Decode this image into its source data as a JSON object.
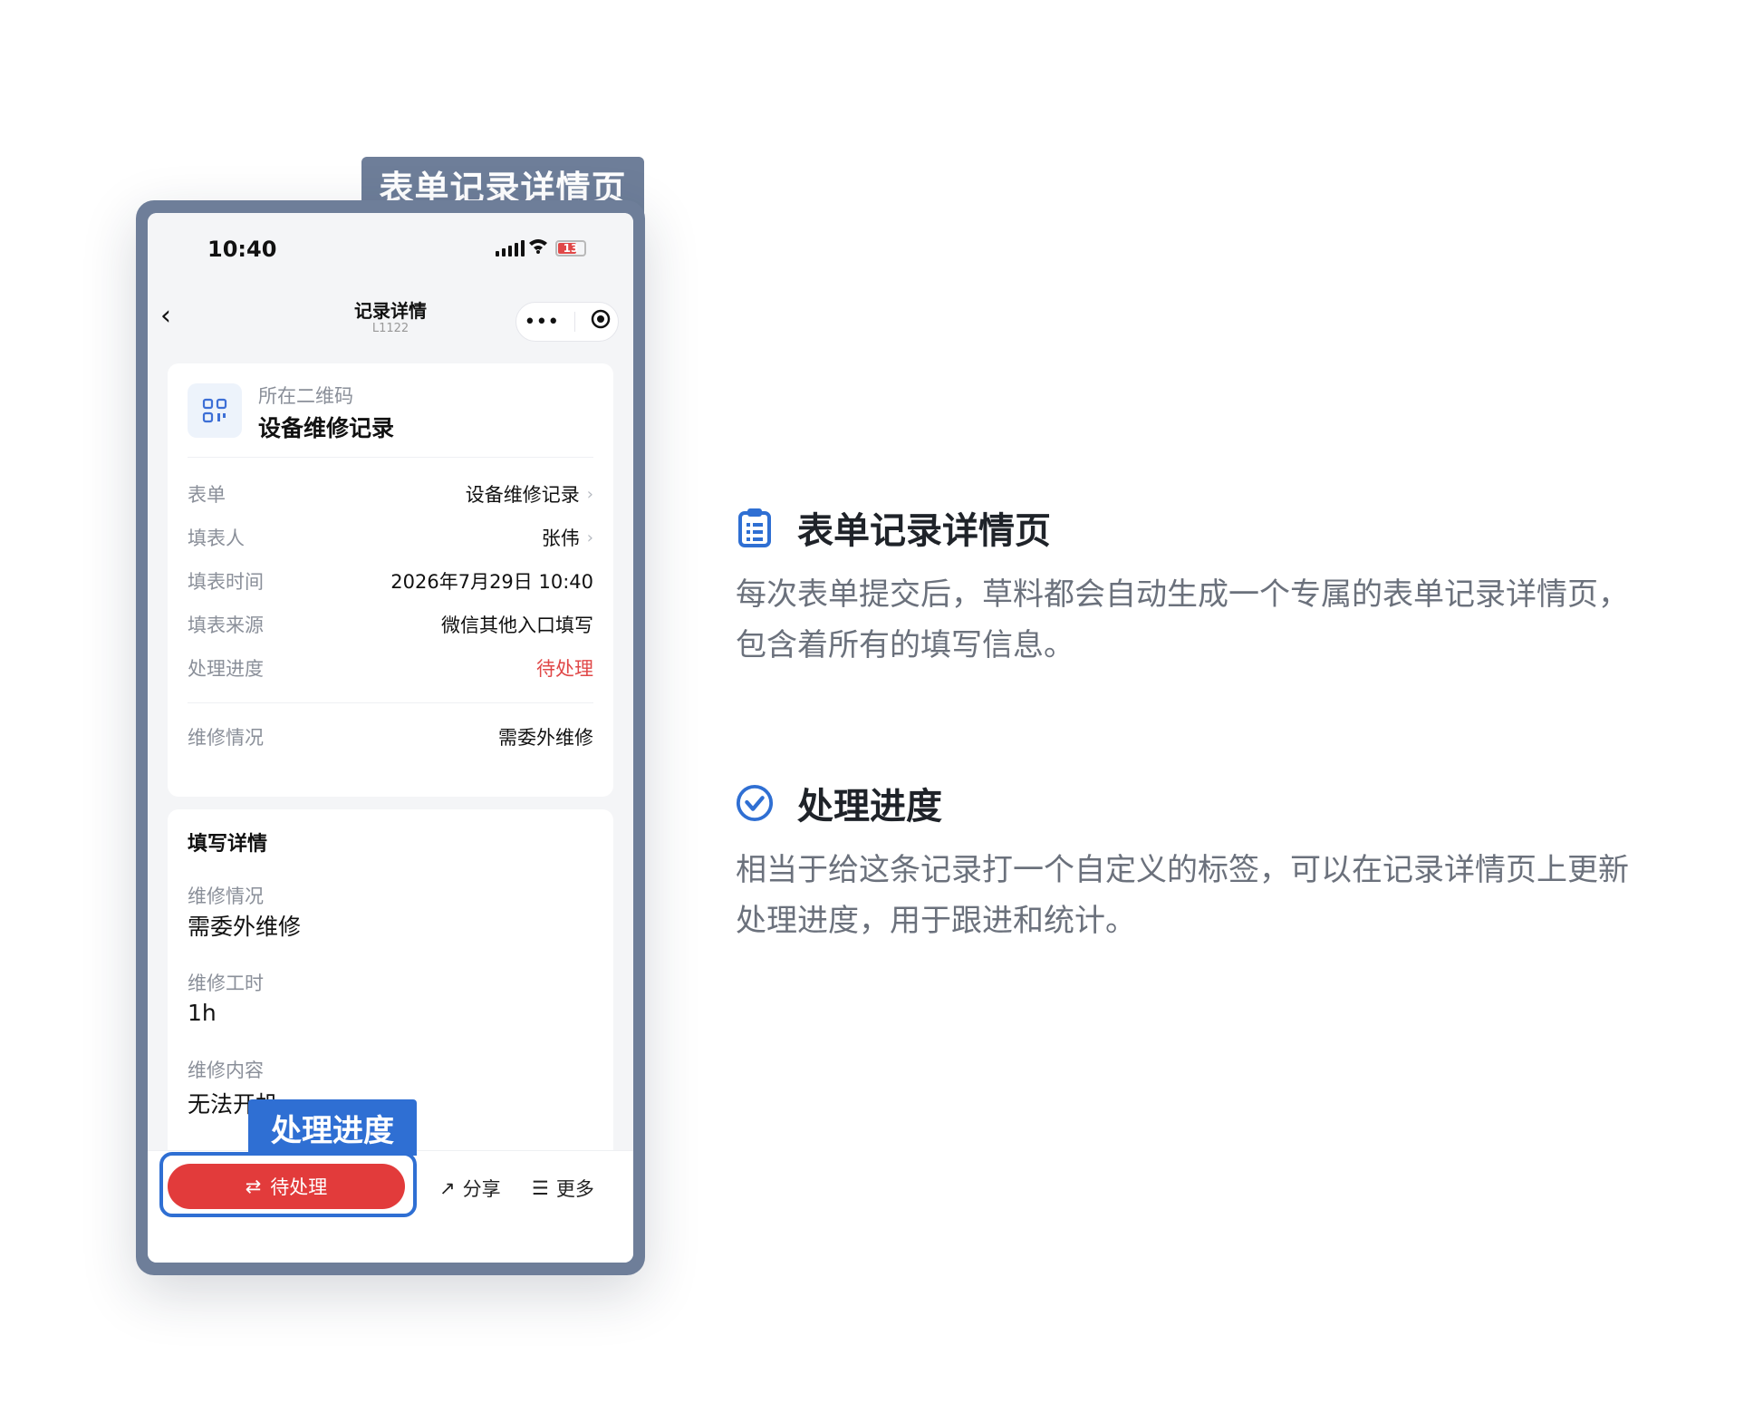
{
  "phone": {
    "tab_label": "表单记录详情页",
    "status": {
      "time": "10:40",
      "battery": "13"
    },
    "nav": {
      "back_icon": "chevron-left-icon",
      "title": "记录详情",
      "subtitle": "L1122",
      "more_icon": "more-dots-icon",
      "target_icon": "target-icon"
    },
    "qr": {
      "label": "所在二维码",
      "title": "设备维修记录"
    },
    "fields": [
      {
        "label": "表单",
        "value": "设备维修记录",
        "arrow": true
      },
      {
        "label": "填表人",
        "value": "张伟",
        "arrow": true
      },
      {
        "label": "填表时间",
        "value": "2026年7月29日 10:40"
      },
      {
        "label": "填表来源",
        "value": "微信其他入口填写"
      },
      {
        "label": "处理进度",
        "value": "待处理",
        "color": "#e04848"
      },
      {
        "label": "维修情况",
        "value": "需委外维修"
      }
    ],
    "details": {
      "title": "填写详情",
      "items": [
        {
          "label": "维修情况",
          "value": "需委外维修"
        },
        {
          "label": "维修工时",
          "value": "1h"
        },
        {
          "label": "维修内容",
          "value": "无法开机"
        }
      ]
    },
    "bottom": {
      "pending": "待处理",
      "share": "分享",
      "more": "更多"
    },
    "highlight_label": "处理进度"
  },
  "features": [
    {
      "icon": "clipboard-icon",
      "title": "表单记录详情页",
      "desc_line1": "每次表单提交后，草料都会自动生成一个专属的表单记录详情页，",
      "desc_line2": "包含着所有的填写信息。"
    },
    {
      "icon": "check-circle-icon",
      "title": "处理进度",
      "desc_line1": "相当于给这条记录打一个自定义的标签，可以在记录详情页上更新",
      "desc_line2": "处理进度，用于跟进和统计。"
    }
  ],
  "colors": {
    "frame": "#6e7e99",
    "accent": "#2f6fd3",
    "danger": "#e23b3b"
  }
}
